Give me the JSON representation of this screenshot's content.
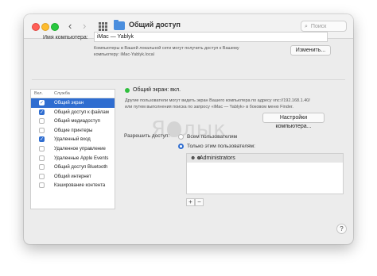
{
  "window": {
    "title": "Общий доступ",
    "search_placeholder": "Поиск"
  },
  "computer": {
    "name_label": "Имя компьютера:",
    "name_value": "iMac — Yablyk",
    "note_line1": "Компьютеры в Вашей локальной сети могут получить доступ к Вашему",
    "note_line2": "компьютеру: iMac-Yablyk.local",
    "change_button": "Изменить..."
  },
  "services": {
    "col_on": "Вкл.",
    "col_service": "Служба",
    "items": [
      {
        "label": "Общий экран",
        "checked": true,
        "selected": true
      },
      {
        "label": "Общий доступ к файлам",
        "checked": true,
        "selected": false
      },
      {
        "label": "Общий медиадоступ",
        "checked": false,
        "selected": false
      },
      {
        "label": "Общие принтеры",
        "checked": false,
        "selected": false
      },
      {
        "label": "Удаленный вход",
        "checked": true,
        "selected": false
      },
      {
        "label": "Удаленное управление",
        "checked": false,
        "selected": false
      },
      {
        "label": "Удаленные Apple Events",
        "checked": false,
        "selected": false
      },
      {
        "label": "Общий доступ Bluetooth",
        "checked": false,
        "selected": false
      },
      {
        "label": "Общий интернет",
        "checked": false,
        "selected": false
      },
      {
        "label": "Кэширование контента",
        "checked": false,
        "selected": false
      }
    ]
  },
  "detail": {
    "status": "Общий экран: вкл.",
    "status_color": "#2fbf3e",
    "desc_line1": "Другие пользователи могут видеть экран Вашего компьютера по адресу vnc://192.168.1.40/",
    "desc_line2": "или путем выполнения поиска по запросу «iMac — Yablyk» в боковом меню Finder.",
    "settings_button": "Настройки компьютера...",
    "allow_label": "Разрешить доступ:",
    "option_all": "Всем пользователям",
    "option_only": "Только этим пользователям:",
    "users": [
      "Administrators"
    ],
    "add_label": "+",
    "remove_label": "−"
  },
  "watermark": {
    "left": "Я",
    "right": "лык"
  },
  "help_label": "?",
  "accent_color": "#2f6dd0"
}
